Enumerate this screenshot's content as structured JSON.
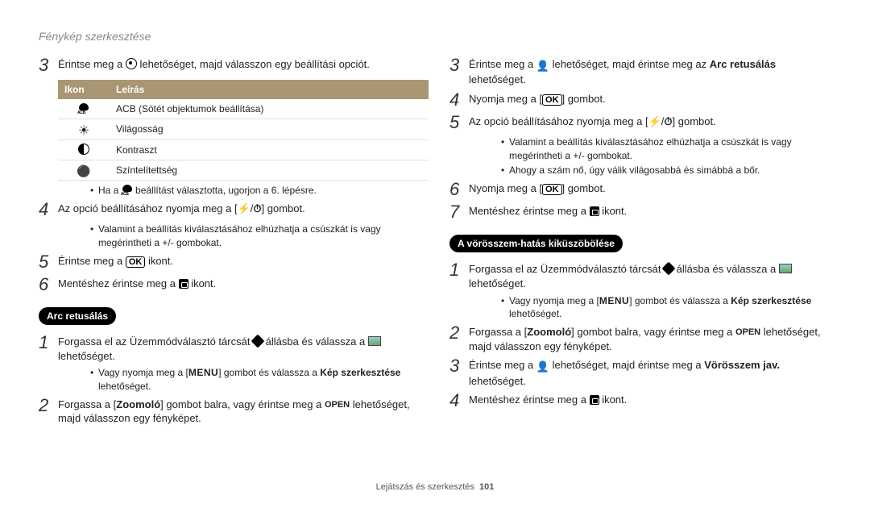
{
  "header": "Fénykép szerkesztése",
  "footer": {
    "section": "Lejátszás és szerkesztés",
    "page": "101"
  },
  "left": {
    "step3": {
      "text_a": "Érintse meg a ",
      "text_b": " lehetőséget, majd válasszon egy beállítási opciót."
    },
    "table": {
      "h_icon": "Ikon",
      "h_desc": "Leírás",
      "rows": [
        {
          "icon": "acb",
          "desc": "ACB (Sötét objektumok beállítása)"
        },
        {
          "icon": "bright",
          "desc": "Világosság"
        },
        {
          "icon": "contrast",
          "desc": "Kontraszt"
        },
        {
          "icon": "sat",
          "desc": "Színtelítettség"
        }
      ]
    },
    "note3": "Ha a       beállítást választotta, ugorjon a 6. lépésre.",
    "step4": {
      "text_a": "Az opció beállításához nyomja meg a [",
      "text_b": "/",
      "text_c": "] gombot."
    },
    "note4": "Valamint a beállítás kiválasztásához elhúzhatja a csúszkát is vagy megérintheti a +/- gombokat.",
    "step5": {
      "text_a": "Érintse meg a ",
      "text_b": " ikont."
    },
    "step6": {
      "text_a": "Mentéshez érintse meg a ",
      "text_b": " ikont."
    },
    "pill1": "Arc retusálás",
    "astep1": {
      "text_a": "Forgassa el az Üzemmódválasztó tárcsát ",
      "text_b": " állásba és válassza a ",
      "text_c": " lehetőséget."
    },
    "anote1": {
      "pre": "Vagy nyomja meg a [",
      "mid": "] gombot és válassza a ",
      "bold": "Kép szerkesztése",
      "post": " lehetőséget."
    },
    "astep2": {
      "text_a": "Forgassa a [",
      "zoom": "Zoomoló",
      "text_b": "] gombot balra, vagy érintse meg a ",
      "open": "OPEN",
      "text_c": " lehetőséget, majd válasszon egy fényképet."
    }
  },
  "right": {
    "step3": {
      "text_a": "Érintse meg a ",
      "text_b": " lehetőséget, majd érintse meg az ",
      "bold": "Arc retusálás",
      "text_c": " lehetőséget."
    },
    "step4": {
      "text_a": "Nyomja meg a [",
      "text_b": "] gombot."
    },
    "step5": {
      "text_a": "Az opció beállításához nyomja meg a [",
      "text_b": "/",
      "text_c": "] gombot."
    },
    "note5a": "Valamint a beállítás kiválasztásához elhúzhatja a csúszkát is vagy megérintheti a +/- gombokat.",
    "note5b": "Ahogy a szám nő, úgy válik világosabbá és simábbá a bőr.",
    "step6": {
      "text_a": "Nyomja meg a [",
      "text_b": "] gombot."
    },
    "step7": {
      "text_a": "Mentéshez érintse meg a ",
      "text_b": " ikont."
    },
    "pill2": "A vörösszem-hatás kiküszöbölése",
    "rstep1": {
      "text_a": "Forgassa el az Üzemmódválasztó tárcsát ",
      "text_b": " állásba és válassza a ",
      "text_c": " lehetőséget."
    },
    "rnote1": {
      "pre": "Vagy nyomja meg a [",
      "mid": "] gombot és válassza a ",
      "bold": "Kép szerkesztése",
      "post": " lehetőséget."
    },
    "rstep2": {
      "text_a": "Forgassa a [",
      "zoom": "Zoomoló",
      "text_b": "] gombot balra, vagy érintse meg a ",
      "open": "OPEN",
      "text_c": " lehetőséget, majd válasszon egy fényképet."
    },
    "rstep3": {
      "text_a": "Érintse meg a ",
      "text_b": " lehetőséget, majd érintse meg a ",
      "bold": "Vörösszem jav.",
      "text_c": " lehetőséget."
    },
    "rstep4": {
      "text_a": "Mentéshez érintse meg a ",
      "text_b": " ikont."
    }
  },
  "menu_label": "MENU"
}
